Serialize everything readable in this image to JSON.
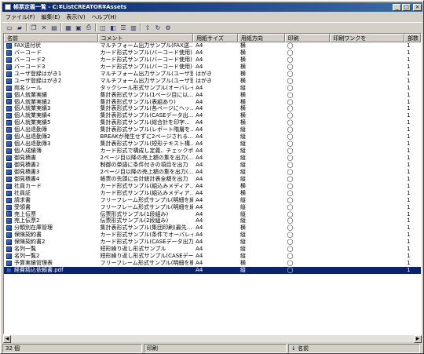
{
  "window": {
    "title": "帳票定義一覧 - C:¥ListCREATOR¥Assets",
    "min_label": "_",
    "max_label": "□",
    "close_label": "×"
  },
  "menu": [
    {
      "label": "ファイル(F)"
    },
    {
      "label": "編集(E)"
    },
    {
      "label": "表示(V)"
    },
    {
      "label": "ヘルプ(H)"
    }
  ],
  "columns": [
    "名前",
    "コメント",
    "用紙サイズ",
    "用紙方向",
    "印刷",
    "印刷ワンクを",
    "部数"
  ],
  "rows": [
    {
      "name": "FAX送付状",
      "comment": "マルチフォーム出力サンプル(FAX送...",
      "size": "A4",
      "orient": "横",
      "print": "◯",
      "copies": "1"
    },
    {
      "name": "バーコード",
      "comment": "カード形式サンプル(バーコード使用)",
      "size": "A4",
      "orient": "横",
      "print": "◯",
      "copies": "1"
    },
    {
      "name": "バーコード2",
      "comment": "カード形式サンプル(バーコード使用)",
      "size": "A4",
      "orient": "横",
      "print": "◯",
      "copies": "1"
    },
    {
      "name": "バーコード3",
      "comment": "カード形式サンプル(バーコード使用)",
      "size": "A4",
      "orient": "横",
      "print": "◯",
      "copies": "1"
    },
    {
      "name": "ユーザ登録はがき1",
      "comment": "マルチフォーム出力サンプル(ユーザ登...",
      "size": "はがき",
      "orient": "横",
      "print": "◯",
      "copies": "1"
    },
    {
      "name": "ユーザ登録はがき2",
      "comment": "マルチフォーム出力サンプル(ユーザ登...",
      "size": "はがき",
      "orient": "横",
      "print": "◯",
      "copies": "1"
    },
    {
      "name": "宛名シール",
      "comment": "タックシール形式サンプル(オーバレイを...",
      "size": "A4",
      "orient": "縦",
      "print": "◯",
      "copies": "1"
    },
    {
      "name": "個人就業実績",
      "comment": "集計表形式サンプル(1ページ目に以...",
      "size": "A4",
      "orient": "横",
      "print": "◯",
      "copies": "1"
    },
    {
      "name": "個人就業実績2",
      "comment": "集計表形式サンプル(表組あり)",
      "size": "A4",
      "orient": "横",
      "print": "◯",
      "copies": "1"
    },
    {
      "name": "個人就業実績3",
      "comment": "集計表形式サンプル(各ページにヘッ...",
      "size": "A4",
      "orient": "横",
      "print": "◯",
      "copies": "1"
    },
    {
      "name": "個人就業実績4",
      "comment": "集計表形式サンプル(CASEデータ出...",
      "size": "A4",
      "orient": "横",
      "print": "◯",
      "copies": "1"
    },
    {
      "name": "個人就業実績5",
      "comment": "集計表形式サンプル(総合計を印字...",
      "size": "A4",
      "orient": "横",
      "print": "◯",
      "copies": "1"
    },
    {
      "name": "個人出退勤簿",
      "comment": "集計表形式サンプル(レポート階層を...",
      "size": "A4",
      "orient": "縦",
      "print": "◯",
      "copies": "1"
    },
    {
      "name": "個人出退勤簿2",
      "comment": "BREAKが発生せずに2ページされる...",
      "size": "A4",
      "orient": "縦",
      "print": "◯",
      "copies": "1"
    },
    {
      "name": "個人出退勤簿3",
      "comment": "集計表形式サンプル(短形テキスト構...",
      "size": "A4",
      "orient": "縦",
      "print": "◯",
      "copies": "1"
    },
    {
      "name": "個人成績簿",
      "comment": "カード形式で構成し定義、チェックボッ...",
      "size": "A4",
      "orient": "縦",
      "print": "◯",
      "copies": "1"
    },
    {
      "name": "御見積書",
      "comment": "2ページ目以降の売上額の集を出力(...",
      "size": "A4",
      "orient": "縦",
      "print": "◯",
      "copies": "1"
    },
    {
      "name": "御見積書2",
      "comment": "制御の単語に条件付きの項目を出力",
      "size": "A4",
      "orient": "縦",
      "print": "◯",
      "copies": "1"
    },
    {
      "name": "御見積書3",
      "comment": "2ページ目以降の売上額の集を出力(...",
      "size": "A4",
      "orient": "縦",
      "print": "◯",
      "copies": "1"
    },
    {
      "name": "御見積書4",
      "comment": "帳票の先頭に合計統計表全額を出力",
      "size": "A4",
      "orient": "縦",
      "print": "◯",
      "copies": "1"
    },
    {
      "name": "社員カード",
      "comment": "カード形式サンプル(組込みメディア...",
      "size": "A4",
      "orient": "横",
      "print": "◯",
      "copies": "1"
    },
    {
      "name": "社員証",
      "comment": "カード形式サンプル(組込みメディア...",
      "size": "A4",
      "orient": "横",
      "print": "◯",
      "copies": "1"
    },
    {
      "name": "請求書",
      "comment": "フリーフレーム形式サンプル(明細を繰...",
      "size": "A4",
      "orient": "縦",
      "print": "◯",
      "copies": "1"
    },
    {
      "name": "受領書",
      "comment": "フリーフレーム形式サンプル(明細を繰...",
      "size": "A4",
      "orient": "縦",
      "print": "◯",
      "copies": "1"
    },
    {
      "name": "売上伝票",
      "comment": "伝票形式サンプル(1段組み)",
      "size": "A4",
      "orient": "縦",
      "print": "◯",
      "copies": "1"
    },
    {
      "name": "売上伝票2",
      "comment": "伝票形式サンプル(2段組み)",
      "size": "A4",
      "orient": "縦",
      "print": "◯",
      "copies": "1"
    },
    {
      "name": "分類別在庫管理",
      "comment": "集計表形式サンプル(集団印刷(最先...",
      "size": "A4",
      "orient": "横",
      "print": "◯",
      "copies": "1"
    },
    {
      "name": "保険契約書",
      "comment": "カード形式サンプル(条件でオーバレイ...",
      "size": "A4",
      "orient": "縦",
      "print": "◯",
      "copies": "1"
    },
    {
      "name": "保険契約書2",
      "comment": "カード形式サンプル(CASEデータ出力...",
      "size": "A4",
      "orient": "縦",
      "print": "◯",
      "copies": "1"
    },
    {
      "name": "名列一覧",
      "comment": "短形繰り返し形式サンプル",
      "size": "A4",
      "orient": "縦",
      "print": "◯",
      "copies": "1"
    },
    {
      "name": "名列一覧2",
      "comment": "短形繰り返し形式サンプル(CASEデー...",
      "size": "A4",
      "orient": "縦",
      "print": "◯",
      "copies": "1"
    },
    {
      "name": "予算実績管理表",
      "comment": "フリーフレーム形式サンプル(明細を横...",
      "size": "A4",
      "orient": "横",
      "print": "◯",
      "copies": "1"
    },
    {
      "name": "経費精込依頼書.pdf",
      "comment": "",
      "size": "A4",
      "orient": "縦",
      "print": "◯",
      "copies": "1",
      "selected": true
    }
  ],
  "status": {
    "count": "32 個",
    "mode": "印刷",
    "sort": "↓ 名前"
  }
}
